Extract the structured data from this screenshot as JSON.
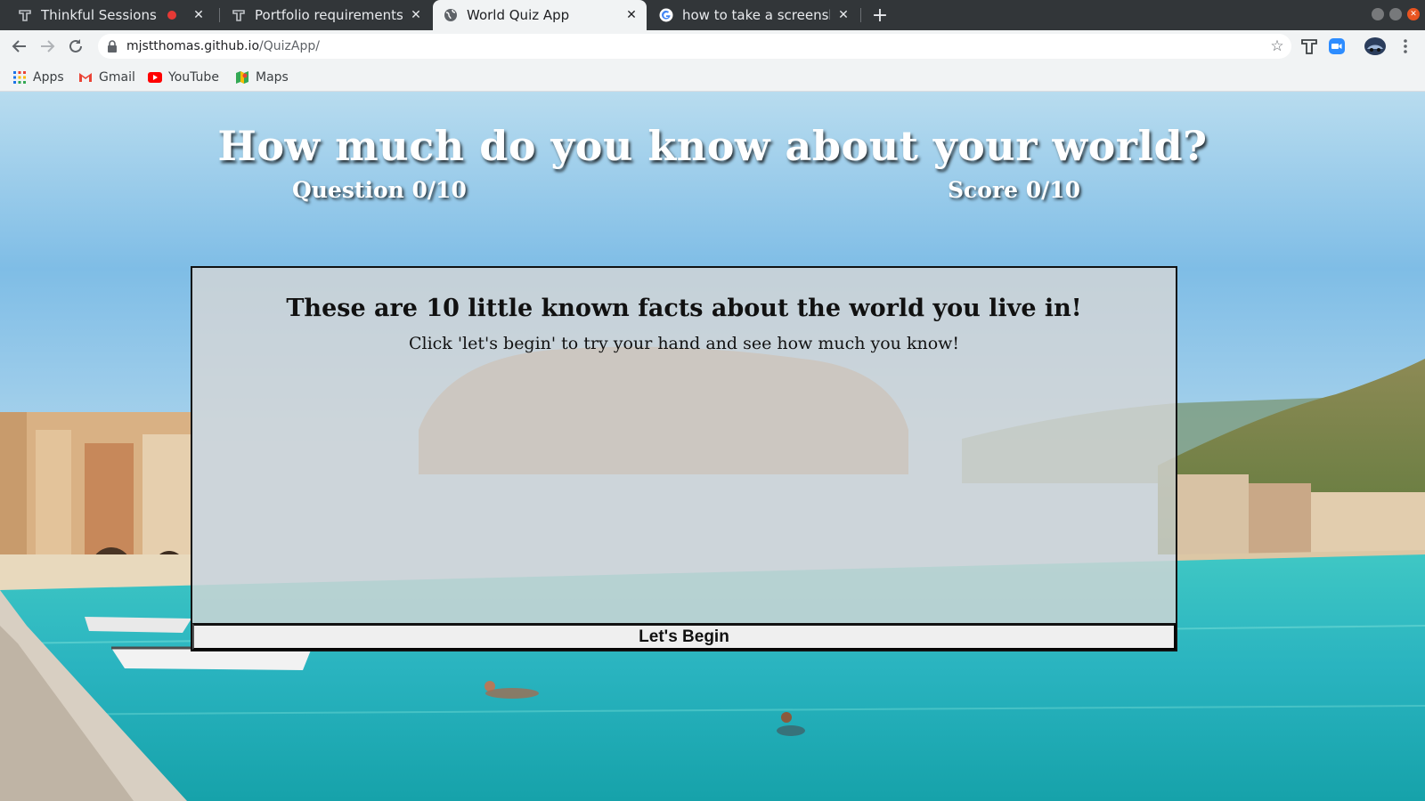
{
  "browser": {
    "tabs": [
      {
        "title": "Thinkful Sessions",
        "icon": "thinkful-icon",
        "recording": true,
        "active": false
      },
      {
        "title": "Portfolio requirements | p",
        "icon": "thinkful-icon",
        "active": false
      },
      {
        "title": "World Quiz App",
        "icon": "globe-icon",
        "active": true
      },
      {
        "title": "how to take a screenshot",
        "icon": "google-icon",
        "active": false
      }
    ],
    "address": {
      "host": "mjstthomas.github.io",
      "path": "/QuizApp/"
    },
    "bookmarks": [
      {
        "label": "Apps",
        "icon": "apps-grid-icon"
      },
      {
        "label": "Gmail",
        "icon": "gmail-icon"
      },
      {
        "label": "YouTube",
        "icon": "youtube-icon"
      },
      {
        "label": "Maps",
        "icon": "maps-icon"
      }
    ],
    "colors": {
      "tabstrip": "#323639",
      "toolbar": "#f1f3f4",
      "close_button": "#e95420"
    }
  },
  "page": {
    "headline": "How much do you know about your world?",
    "question_counter": "Question 0/10",
    "score_counter": "Score 0/10",
    "quiz": {
      "heading": "These are 10 little known facts about the world you live in!",
      "instructions": "Click 'let's begin' to try your hand and see how much you know!",
      "start_button": "Let's Begin"
    }
  }
}
